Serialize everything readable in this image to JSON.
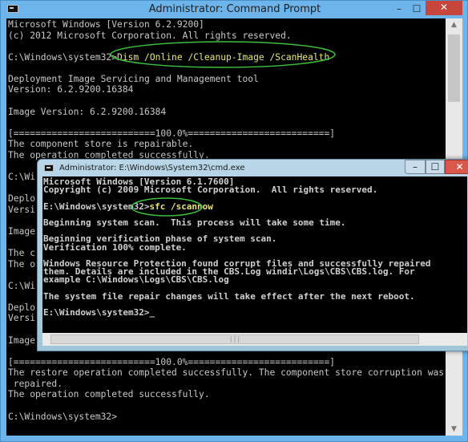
{
  "outer_window": {
    "title": "Administrator: Command Prompt",
    "controls": {
      "minimize": "–",
      "maximize": "☐",
      "close": "✕"
    },
    "lines": [
      "Microsoft Windows [Version 6.2.9200]",
      "(c) 2012 Microsoft Corporation. All rights reserved.",
      "",
      "C:\\Windows\\system32>",
      "",
      "Deployment Image Servicing and Management tool",
      "Version: 6.2.9200.16384",
      "",
      "Image Version: 6.2.9200.16384",
      "",
      "[==========================100.0%==========================]",
      "The component store is repairable.",
      "The operation completed successfully.",
      "",
      "C:\\Wi",
      "",
      "Deplo",
      "Versi",
      "",
      "Image",
      "",
      "The c",
      "The o",
      "",
      "C:\\Wi",
      "",
      "Deplo",
      "Versi",
      "",
      "Image",
      "",
      "[==========================100.0%==========================]",
      "The restore operation completed successfully. The component store corruption was",
      " repaired.",
      "The operation completed successfully.",
      "",
      "C:\\Windows\\system32>"
    ],
    "command": "Dism /Online /Cleanup-Image /ScanHealth"
  },
  "inner_window": {
    "title": "Administrator: E:\\Windows\\System32\\cmd.exe",
    "controls": {
      "minimize": "–",
      "maximize": "☐",
      "close": "✕"
    },
    "lines": [
      "Microsoft Windows [Version 6.1.7600]",
      "Copyright (c) 2009 Microsoft Corporation.  All rights reserved.",
      "",
      "E:\\Windows\\system32>",
      "",
      "Beginning system scan.  This process will take some time.",
      "",
      "Beginning verification phase of system scan.",
      "Verification 100% complete.",
      "",
      "Windows Resource Protection found corrupt files and successfully repaired",
      "them. Details are included in the CBS.Log windir\\Logs\\CBS\\CBS.log. For",
      "example C:\\Windows\\Logs\\CBS\\CBS.log",
      "",
      "The system file repair changes will take effect after the next reboot.",
      "",
      "E:\\Windows\\system32>_"
    ],
    "command": "sfc /scannow"
  },
  "colors": {
    "highlight_ellipse": "#3fbf3f",
    "command_text": "#e8e67a",
    "titlebar": "#6cb4ea"
  }
}
